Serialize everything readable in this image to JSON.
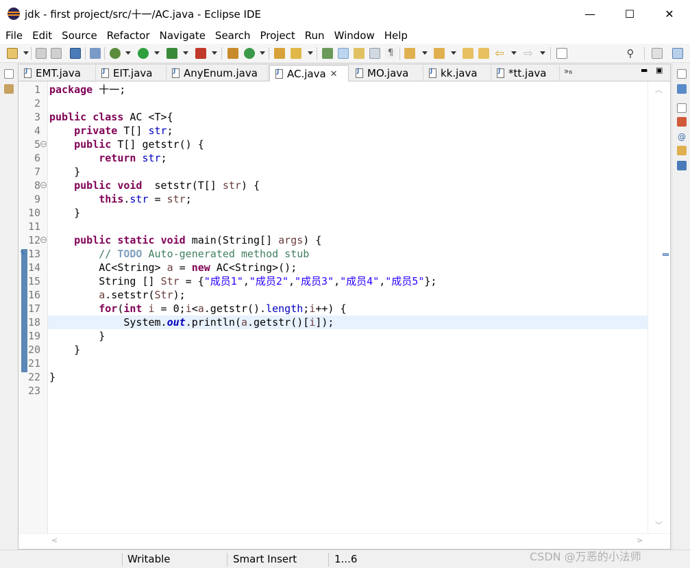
{
  "window": {
    "title": "jdk - first project/src/十一/AC.java - Eclipse IDE",
    "minimize": "—",
    "maximize": "☐",
    "close": "✕"
  },
  "menu": [
    "File",
    "Edit",
    "Source",
    "Refactor",
    "Navigate",
    "Search",
    "Project",
    "Run",
    "Window",
    "Help"
  ],
  "tabs": [
    {
      "label": "EMT.java"
    },
    {
      "label": "EIT.java"
    },
    {
      "label": "AnyEnum.java"
    },
    {
      "label": "AC.java",
      "active": true
    },
    {
      "label": "MO.java"
    },
    {
      "label": "kk.java"
    },
    {
      "label": "*tt.java"
    }
  ],
  "tab_overflow": "»₆",
  "code_lines": [
    {
      "n": "1"
    },
    {
      "n": "2"
    },
    {
      "n": "3"
    },
    {
      "n": "4"
    },
    {
      "n": "5"
    },
    {
      "n": "6"
    },
    {
      "n": "7"
    },
    {
      "n": "8"
    },
    {
      "n": "9"
    },
    {
      "n": "10"
    },
    {
      "n": "11"
    },
    {
      "n": "12"
    },
    {
      "n": "13"
    },
    {
      "n": "14"
    },
    {
      "n": "15"
    },
    {
      "n": "16"
    },
    {
      "n": "17"
    },
    {
      "n": "18"
    },
    {
      "n": "19"
    },
    {
      "n": "20"
    },
    {
      "n": "21"
    },
    {
      "n": "22"
    },
    {
      "n": "23"
    }
  ],
  "code": {
    "l1_kw": "package",
    "l1_rest": " 十一;",
    "l3_kw1": "public",
    "l3_kw2": "class",
    "l3_rest": " AC <T>{",
    "l4_kw": "private",
    "l4_mid": " T[] ",
    "l4_fld": "str",
    "l4_end": ";",
    "l5_kw": "public",
    "l5_rest": " T[] getstr() {",
    "l6_kw": "return",
    "l6_fld": "str",
    "l6_end": ";",
    "l7": "}",
    "l8_kw1": "public",
    "l8_kw2": "void",
    "l8_mid": "  setstr(T[] ",
    "l8_var": "str",
    "l8_end": ") {",
    "l9_kw": "this",
    "l9_dot": ".",
    "l9_fld": "str",
    "l9_mid": " = ",
    "l9_var": "str",
    "l9_end": ";",
    "l10": "}",
    "l12_kw1": "public",
    "l12_kw2": "static",
    "l12_kw3": "void",
    "l12_mid": " main(String[] ",
    "l12_var": "args",
    "l12_end": ") {",
    "l13_c1": "// ",
    "l13_todo": "TODO",
    "l13_c2": " Auto-generated method stub",
    "l14_a": "AC<String> ",
    "l14_var": "a",
    "l14_b": " = ",
    "l14_kw": "new",
    "l14_c": " AC<String>();",
    "l15_a": "String [] ",
    "l15_var": "Str",
    "l15_b": " = {",
    "l15_s1": "\"成员1\"",
    "l15_s2": "\"成员2\"",
    "l15_s3": "\"成员3\"",
    "l15_s4": "\"成员4\"",
    "l15_s5": "\"成员5\"",
    "l15_comma": ",",
    "l15_end": "};",
    "l16_var": "a",
    "l16_mid": ".setstr(",
    "l16_var2": "Str",
    "l16_end": ");",
    "l17_kw1": "for",
    "l17_a": "(",
    "l17_kw2": "int",
    "l17_b": " ",
    "l17_i1": "i",
    "l17_c": " = 0;",
    "l17_i2": "i",
    "l17_d": "<",
    "l17_v": "a",
    "l17_e": ".getstr().",
    "l17_len": "length",
    "l17_f": ";",
    "l17_i3": "i",
    "l17_g": "++) {",
    "l18_a": "System.",
    "l18_out": "out",
    "l18_b": ".println(",
    "l18_v": "a",
    "l18_c": ".getstr()[",
    "l18_i": "i",
    "l18_d": "]);",
    "l19": "}",
    "l20": "}",
    "l22": "}"
  },
  "status": {
    "writable": "Writable",
    "insert_mode": "Smart Insert",
    "position": "1...6"
  },
  "watermark": "CSDN @万恶的小法师",
  "colors": {
    "keyword": "#7f0055",
    "field": "#0000c0",
    "string": "#2a00ff",
    "comment": "#3f7f5f",
    "highlight_line": "#e8f2fe"
  }
}
